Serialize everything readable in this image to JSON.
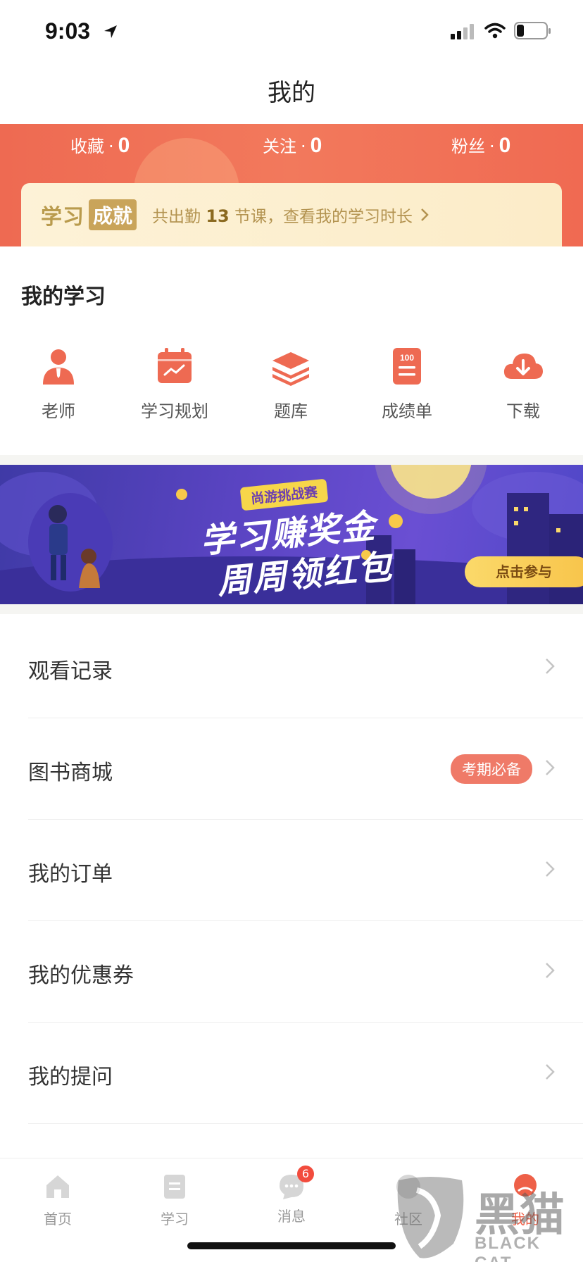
{
  "status_bar": {
    "time": "9:03"
  },
  "header": {
    "title": "我的"
  },
  "stats": [
    {
      "label": "收藏",
      "value": "0"
    },
    {
      "label": "关注",
      "value": "0"
    },
    {
      "label": "粉丝",
      "value": "0"
    }
  ],
  "achievement": {
    "title_part1": "学习",
    "title_part2": "成就",
    "text_before": "共出勤",
    "count": "13",
    "text_after": "节课，查看我的学习时长"
  },
  "my_study": {
    "title": "我的学习",
    "items": [
      {
        "label": "老师",
        "icon": "teacher-icon"
      },
      {
        "label": "学习规划",
        "icon": "calendar-plan-icon"
      },
      {
        "label": "题库",
        "icon": "layers-icon"
      },
      {
        "label": "成绩单",
        "icon": "score-report-icon"
      },
      {
        "label": "下载",
        "icon": "cloud-download-icon"
      }
    ]
  },
  "banner": {
    "tag": "尚游挑战赛",
    "line1": "学习赚奖金",
    "line2": "周周领红包",
    "cta": "点击参与"
  },
  "menu": [
    {
      "label": "观看记录"
    },
    {
      "label": "图书商城",
      "badge": "考期必备"
    },
    {
      "label": "我的订单"
    },
    {
      "label": "我的优惠券"
    },
    {
      "label": "我的提问"
    }
  ],
  "tabs": [
    {
      "label": "首页",
      "icon": "home-icon"
    },
    {
      "label": "学习",
      "icon": "study-icon"
    },
    {
      "label": "消息",
      "icon": "message-icon",
      "badge": "6"
    },
    {
      "label": "社区",
      "icon": "community-icon"
    },
    {
      "label": "我的",
      "icon": "profile-icon",
      "active": true
    }
  ],
  "watermark": {
    "cn": "黑猫",
    "en": "BLACK CAT"
  },
  "colors": {
    "accent": "#ee6a52",
    "gold": "#c9a45a",
    "tab_active": "#ee6048"
  }
}
